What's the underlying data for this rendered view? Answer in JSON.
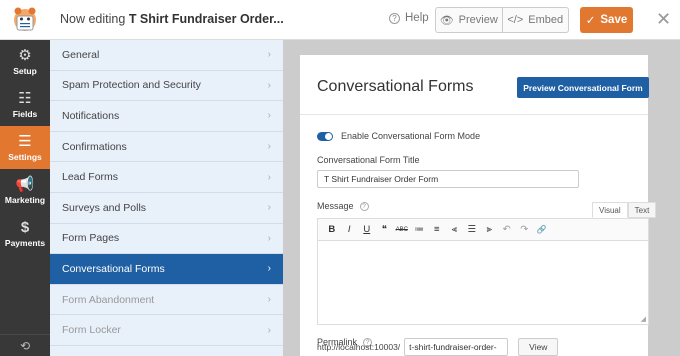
{
  "topbar": {
    "editing_prefix": "Now editing",
    "form_name": "T Shirt Fundraiser Order...",
    "help_label": "Help",
    "preview_label": "Preview",
    "embed_label": "Embed",
    "save_label": "Save"
  },
  "leftnav": {
    "items": [
      {
        "label": "Setup",
        "icon": "gear-icon"
      },
      {
        "label": "Fields",
        "icon": "fields-icon"
      },
      {
        "label": "Settings",
        "icon": "sliders-icon"
      },
      {
        "label": "Marketing",
        "icon": "megaphone-icon"
      },
      {
        "label": "Payments",
        "icon": "dollar-icon"
      }
    ]
  },
  "settings_panel": {
    "items": [
      {
        "label": "General"
      },
      {
        "label": "Spam Protection and Security"
      },
      {
        "label": "Notifications"
      },
      {
        "label": "Confirmations"
      },
      {
        "label": "Lead Forms"
      },
      {
        "label": "Surveys and Polls"
      },
      {
        "label": "Form Pages"
      },
      {
        "label": "Conversational Forms"
      },
      {
        "label": "Form Abandonment"
      },
      {
        "label": "Form Locker"
      }
    ],
    "active_index": 7
  },
  "main": {
    "title": "Conversational Forms",
    "preview_button": "Preview Conversational Form",
    "toggle_label": "Enable Conversational Form Mode",
    "toggle_on": true,
    "form_title_label": "Conversational Form Title",
    "form_title_value": "T Shirt Fundraiser Order Form",
    "message_label": "Message",
    "tab_visual": "Visual",
    "tab_text": "Text",
    "toolbar": [
      "B",
      "I",
      "U",
      "❝",
      "ABC",
      "≔",
      "≡",
      "⫷",
      "☰",
      "⫸",
      "↶",
      "↷",
      "🔗"
    ],
    "permalink_label": "Permalink",
    "permalink_base": "http://localhost:10003/",
    "permalink_slug": "t-shirt-fundraiser-order-",
    "view_button": "View"
  },
  "colors": {
    "accent_orange": "#e27730",
    "accent_blue": "#1f5fa4",
    "nav_bg": "#383838",
    "panel_bg": "#e8f0fa"
  }
}
